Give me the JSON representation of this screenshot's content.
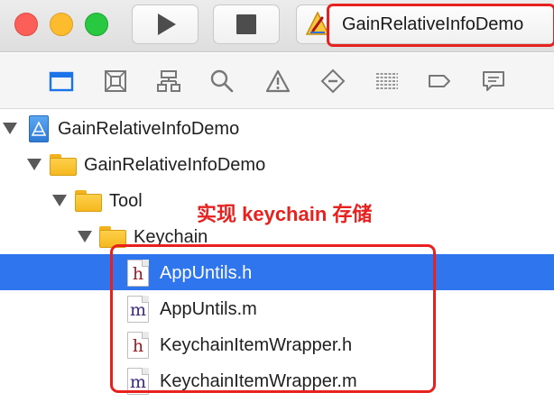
{
  "toolbar": {
    "scheme_name": "GainRelativeInfoDemo",
    "icons": [
      "close-light",
      "minimize-light",
      "zoom-light",
      "play-icon",
      "stop-icon",
      "xcode-app-icon"
    ]
  },
  "navigator": {
    "icons": [
      "project-navigator-icon",
      "source-control-icon",
      "symbol-navigator-icon",
      "find-icon",
      "issue-icon",
      "test-icon",
      "debug-icon",
      "breakpoint-icon",
      "report-icon"
    ],
    "selected": "project-navigator-icon"
  },
  "tree": {
    "project": "GainRelativeInfoDemo",
    "group": "GainRelativeInfoDemo",
    "tool_folder": "Tool",
    "keychain_folder": "Keychain",
    "files": [
      {
        "name": "AppUntils.h",
        "type": "h"
      },
      {
        "name": "AppUntils.m",
        "type": "m"
      },
      {
        "name": "KeychainItemWrapper.h",
        "type": "h"
      },
      {
        "name": "KeychainItemWrapper.m",
        "type": "m"
      }
    ],
    "selected_file": "AppUntils.h"
  },
  "annotation": {
    "text": "实现 keychain 存储"
  },
  "colors": {
    "annotation": "#e8211f",
    "selection": "#2e75ee",
    "nav_active": "#1a73e8"
  }
}
